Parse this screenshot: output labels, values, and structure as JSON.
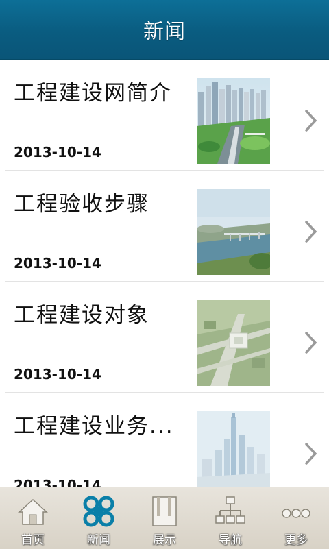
{
  "header": {
    "title": "新闻"
  },
  "news": [
    {
      "title": "工程建设网简介",
      "date": "2013-10-14",
      "thumb_icon": "city-skyline-image"
    },
    {
      "title": "工程验收步骤",
      "date": "2013-10-14",
      "thumb_icon": "river-bridge-image"
    },
    {
      "title": "工程建设对象",
      "date": "2013-10-14",
      "thumb_icon": "site-plan-image"
    },
    {
      "title": "工程建设业务...",
      "date": "2013-10-14",
      "thumb_icon": "city-towers-image"
    }
  ],
  "tabs": [
    {
      "label": "首页",
      "icon": "home-icon",
      "active": false
    },
    {
      "label": "新闻",
      "icon": "news-icon",
      "active": true
    },
    {
      "label": "展示",
      "icon": "display-icon",
      "active": false
    },
    {
      "label": "导航",
      "icon": "navigation-icon",
      "active": false
    },
    {
      "label": "更多",
      "icon": "more-icon",
      "active": false
    }
  ],
  "colors": {
    "header": "#0a5c80",
    "active_tab": "#0a7fa8",
    "inactive_tab": "#f4f2ee"
  }
}
